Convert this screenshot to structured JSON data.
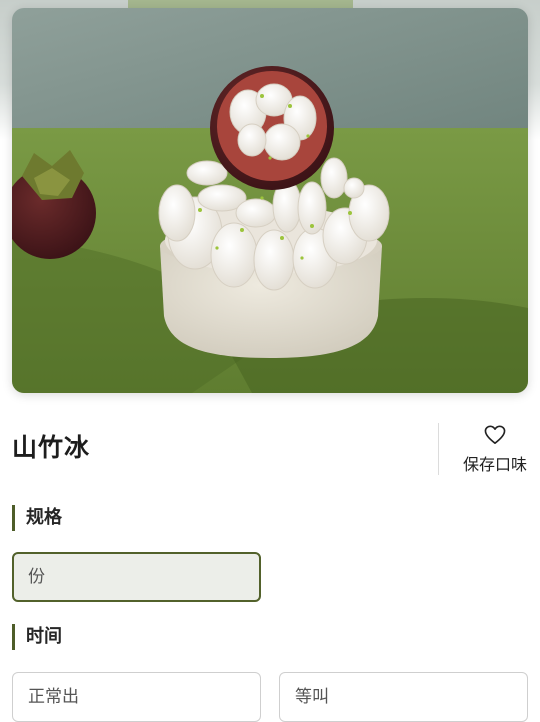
{
  "product": {
    "name": "山竹冰",
    "image_alt": "mangosteen-ice-dessert-photo"
  },
  "favorite": {
    "label": "保存口味",
    "icon": "heart-outline-icon"
  },
  "sections": {
    "spec": {
      "title": "规格",
      "options": [
        {
          "label": "份",
          "selected": true
        }
      ]
    },
    "time": {
      "title": "时间",
      "options": [
        {
          "label": "正常出",
          "selected": false
        },
        {
          "label": "等叫",
          "selected": false
        }
      ]
    }
  },
  "colors": {
    "accent": "#52612b",
    "selected_bg": "#eceee9",
    "border": "#cfcfcf"
  }
}
